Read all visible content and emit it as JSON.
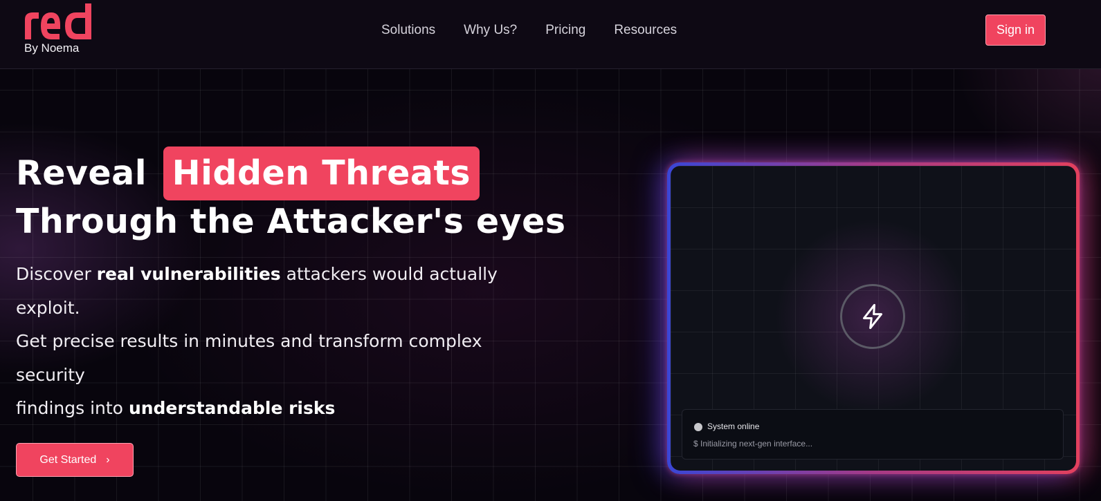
{
  "header": {
    "logo_text": "red",
    "logo_byline": "By Noema",
    "nav": [
      "Solutions",
      "Why Us?",
      "Pricing",
      "Resources"
    ],
    "signin_label": "Sign in"
  },
  "hero": {
    "title_prefix": "Reveal",
    "title_highlight": "Hidden Threats",
    "title_line2": "Through the Attacker's eyes",
    "sub_1": "Discover ",
    "sub_1_bold": "real vulnerabilities",
    "sub_2": " attackers would actually exploit.",
    "sub_3": "Get precise results in minutes and transform complex security",
    "sub_4": "findings into ",
    "sub_4_bold": "understandable risks",
    "cta_label": "Get Started",
    "cta_icon": "chevron-right-icon"
  },
  "panel": {
    "center_icon": "lightning-bolt-icon",
    "status_title": "System online",
    "status_line": "$ Initializing next-gen interface..."
  },
  "colors": {
    "accent": "#f0445f",
    "background": "#08050d",
    "panel_glow_left": "#3a46d6",
    "panel_glow_right": "#e2405e"
  }
}
